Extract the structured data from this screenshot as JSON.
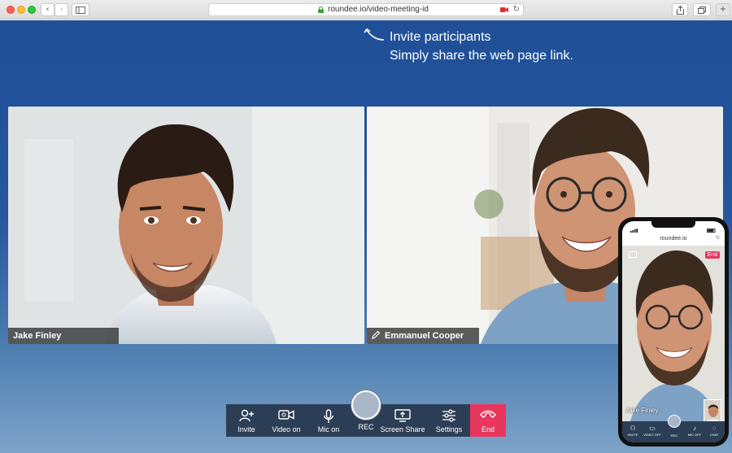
{
  "browser": {
    "url": "roundee.io/video-meeting-id",
    "nav_back": "‹",
    "nav_forward": "›"
  },
  "hint": {
    "title": "Invite participants",
    "subtitle": "Simply share the web page link."
  },
  "participants": [
    {
      "name": "Jake Finley"
    },
    {
      "name": "Emmanuel Cooper"
    }
  ],
  "controls": {
    "invite": "Invite",
    "video": "Video on",
    "mic": "Mic on",
    "rec": "REC",
    "screen_share": "Screen Share",
    "settings": "Settings",
    "end": "End"
  },
  "phone": {
    "url": "roundee.io",
    "end": "End",
    "name": "Jake Finley",
    "controls": {
      "invite": "INVITE",
      "video": "VIDEO OFF",
      "rec": "REC",
      "mic": "MIC OFF",
      "chat": "CHAT"
    }
  },
  "colors": {
    "app_bg": "#1f4f97",
    "control_bar": "#2c3e55",
    "end_button": "#e8365d"
  }
}
